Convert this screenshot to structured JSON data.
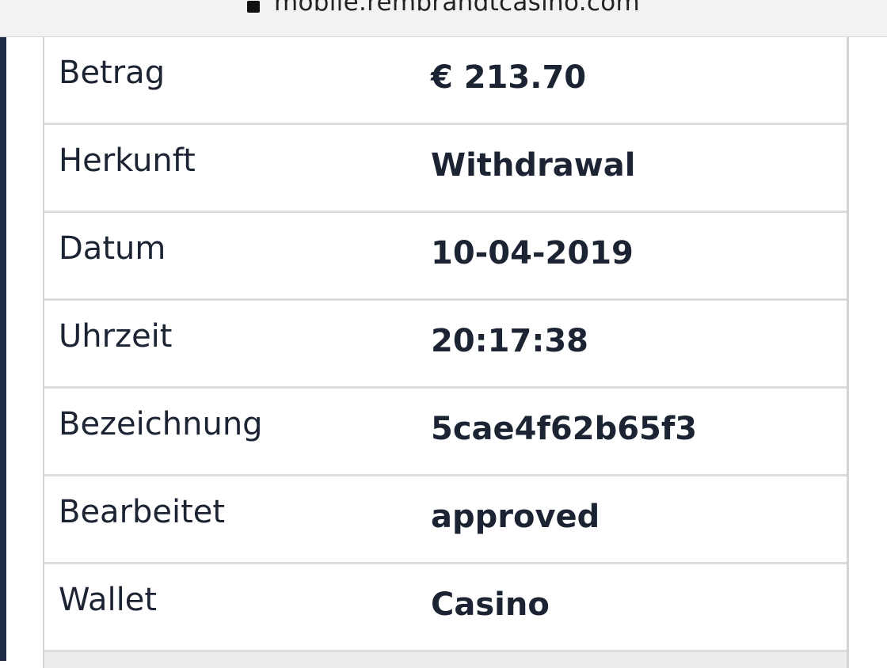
{
  "browser": {
    "url": "mobile.rembrandtcasino.com",
    "lock_icon": "lock-icon"
  },
  "transaction": {
    "rows": [
      {
        "label": "Betrag",
        "value": "€ 213.70"
      },
      {
        "label": "Herkunft",
        "value": "Withdrawal"
      },
      {
        "label": "Datum",
        "value": "10-04-2019"
      },
      {
        "label": "Uhrzeit",
        "value": "20:17:38"
      },
      {
        "label": "Bezeichnung",
        "value": "5cae4f62b65f3"
      },
      {
        "label": "Bearbeitet",
        "value": "approved"
      },
      {
        "label": "Wallet",
        "value": "Casino"
      }
    ]
  },
  "colors": {
    "text": "#1c2433",
    "accent_bar": "#1f2a44",
    "border": "#dcdcdc",
    "browser_bar": "#f2f2f2"
  }
}
